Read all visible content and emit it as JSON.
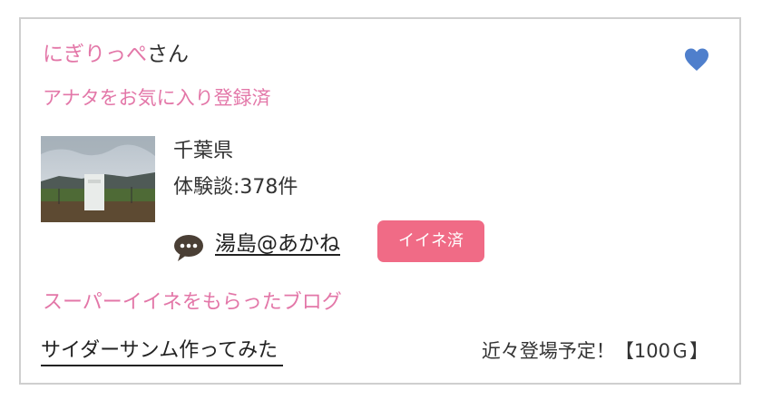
{
  "card": {
    "user_name": "にぎりっぺ",
    "user_suffix": "さん",
    "favorite_status": "アナタをお気に入り登録済",
    "prefecture": "千葉県",
    "experience_count": "体験談:378件",
    "comment_author": "湯島@あかね",
    "like_badge": "イイネ済",
    "super_like_heading": "スーパーイイネをもらったブログ",
    "blog_title": "サイダーサンム作ってみた",
    "upcoming_status": "近々登場予定！【100Ｇ】"
  },
  "icons": {
    "heart": "heart-icon",
    "comment": "speech-bubble-icon"
  },
  "colors": {
    "accent_pink": "#e377a8",
    "badge_pink": "#f06b86",
    "heart_blue": "#4f7fcc",
    "border": "#cfcfcf"
  }
}
